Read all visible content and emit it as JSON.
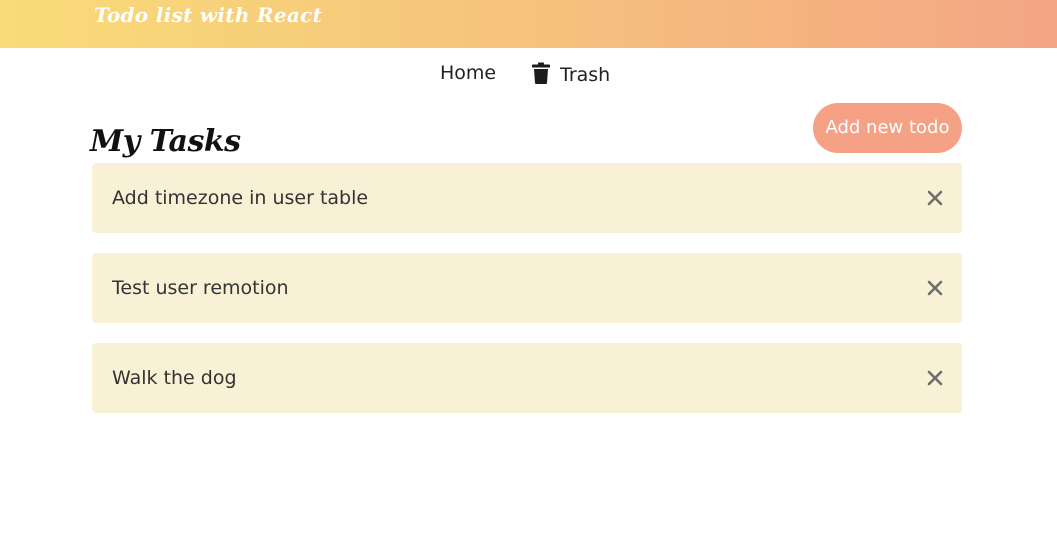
{
  "header": {
    "brand": "Todo list with React"
  },
  "nav": {
    "home_label": "Home",
    "trash_label": "Trash",
    "trash_icon": "trash-icon"
  },
  "main": {
    "title": "My Tasks",
    "add_button_label": "Add new todo",
    "todos": [
      {
        "text": "Add timezone in user table",
        "action_icon": "close-icon"
      },
      {
        "text": "Test user remotion",
        "action_icon": "close-icon"
      },
      {
        "text": "Walk the dog",
        "action_icon": "close-icon"
      }
    ]
  },
  "colors": {
    "header_gradient_start": "#f8dc78",
    "header_gradient_end": "#f4a584",
    "accent_button": "#f4a185",
    "todo_background": "#f9f1d5"
  }
}
